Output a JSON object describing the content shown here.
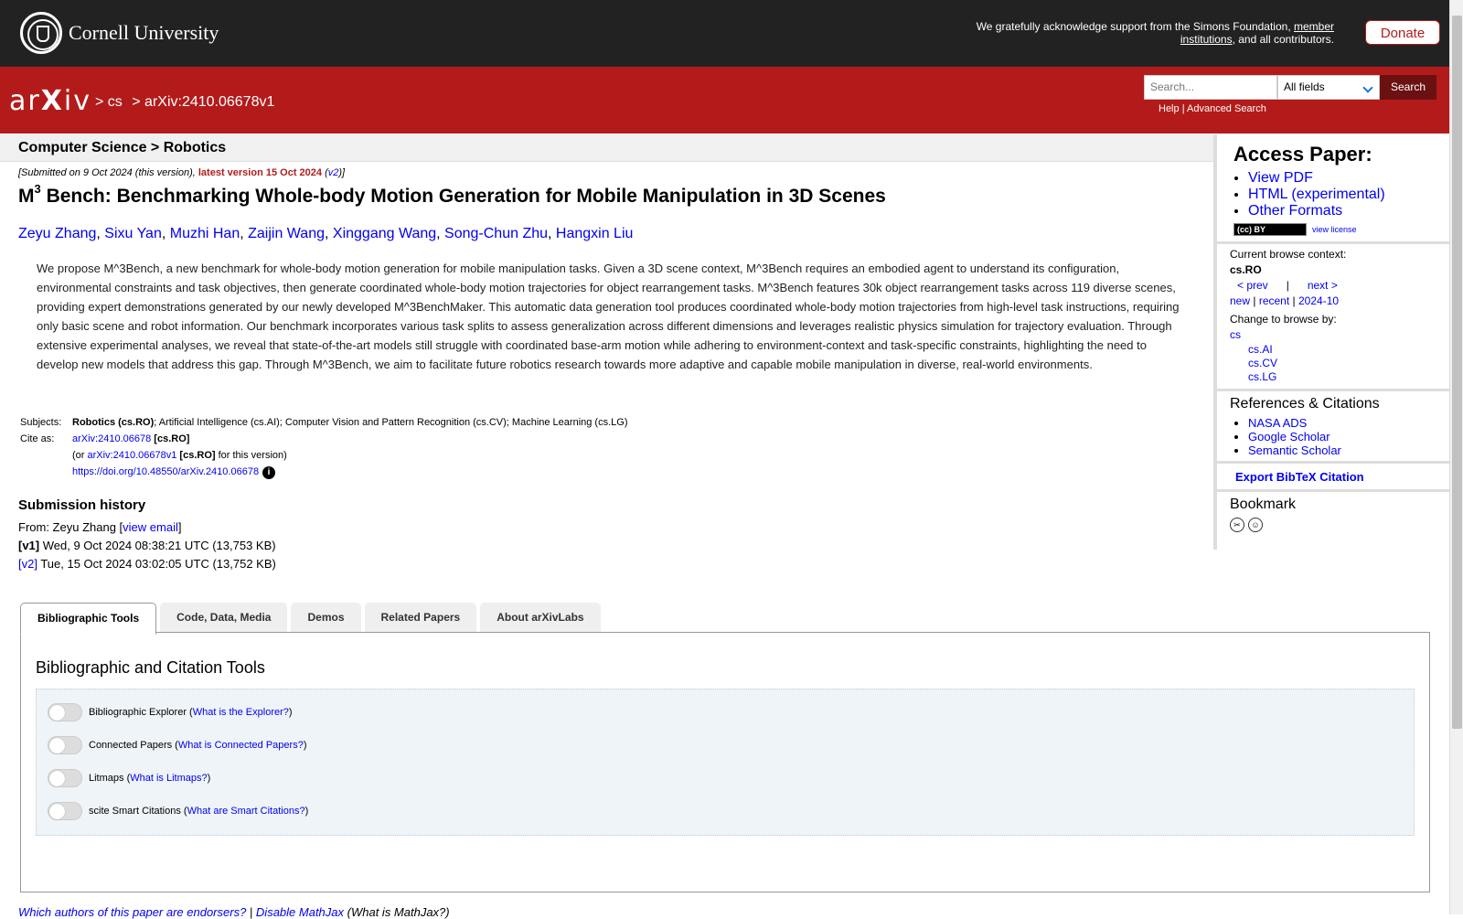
{
  "topbar": {
    "logo_text": "Cornell University",
    "ack_text": "We gratefully acknowledge support from the Simons Foundation, ",
    "ack_link": "member institutions",
    "ack_end": ", and all contributors.",
    "donate": "Donate"
  },
  "header": {
    "logo_a": "ar",
    "logo_x": "X",
    "logo_b": "iv",
    "crumb1": "> cs",
    "crumb2": "> arXiv:2410.06678v1",
    "search_placeholder": "Search...",
    "search_field": "All fields",
    "search_button": "Search",
    "help": "Help",
    "sep": "|",
    "advanced": "Advanced Search"
  },
  "subject_heading": "Computer Science > Robotics",
  "dateline": {
    "prefix": "[Submitted on 9 Oct 2024 (this version), ",
    "latest": "latest version 15 Oct 2024",
    "paren_open": " (",
    "v2": "v2",
    "suffix": ")]"
  },
  "title": {
    "m": "M",
    "sup": "3",
    "rest": "Bench: Benchmarking Whole-body Motion Generation for Mobile Manipulation in 3D Scenes"
  },
  "authors": [
    "Zeyu Zhang",
    "Sixu Yan",
    "Muzhi Han",
    "Zaijin Wang",
    "Xinggang Wang",
    "Song-Chun Zhu",
    "Hangxin Liu"
  ],
  "abstract": "We propose M^3Bench, a new benchmark for whole-body motion generation for mobile manipulation tasks. Given a 3D scene context, M^3Bench requires an embodied agent to understand its configuration, environmental constraints and task objectives, then generate coordinated whole-body motion trajectories for object rearrangement tasks. M^3Bench features 30k object rearrangement tasks across 119 diverse scenes, providing expert demonstrations generated by our newly developed M^3BenchMaker. This automatic data generation tool produces coordinated whole-body motion trajectories from high-level task instructions, requiring only basic scene and robot information. Our benchmark incorporates various task splits to assess generalization across different dimensions and leverages realistic physics simulation for trajectory evaluation. Through extensive experimental analyses, we reveal that state-of-the-art models still struggle with coordinated base-arm motion while adhering to environment-context and task-specific constraints, highlighting the need to develop new models that address this gap. Through M^3Bench, we aim to facilitate future robotics research towards more adaptive and capable mobile manipulation in diverse, real-world environments.",
  "meta": {
    "subjects_label": "Subjects:",
    "subjects_primary": "Robotics (cs.RO)",
    "subjects_rest": "; Artificial Intelligence (cs.AI); Computer Vision and Pattern Recognition (cs.CV); Machine Learning (cs.LG)",
    "cite_label": "Cite as:",
    "cite_id": "arXiv:2410.06678",
    "cite_cat": "[cs.RO]",
    "cite2_pre": "(or ",
    "cite2_id": "arXiv:2410.06678v1",
    "cite2_cat": "[cs.RO]",
    "cite2_post": " for this version)",
    "doi": "https://doi.org/10.48550/arXiv.2410.06678",
    "info_glyph": "i"
  },
  "history": {
    "heading": "Submission history",
    "from_pre": "From: Zeyu Zhang [",
    "from_link": "view email",
    "from_post": "]",
    "v1_label": "[v1]",
    "v1_text": " Wed, 9 Oct 2024 08:38:21 UTC (13,753 KB)",
    "v2_label": "[v2]",
    "v2_text": " Tue, 15 Oct 2024 03:02:05 UTC (13,752 KB)"
  },
  "tabs": [
    "Bibliographic Tools",
    "Code, Data, Media",
    "Demos",
    "Related Papers",
    "About arXivLabs"
  ],
  "panel": {
    "title": "Bibliographic and Citation Tools",
    "tools": [
      {
        "label": "Bibliographic Explorer (",
        "link": "What is the Explorer?",
        "end": ")"
      },
      {
        "label": "Connected Papers (",
        "link": "What is Connected Papers?",
        "end": ")"
      },
      {
        "label": "Litmaps (",
        "link": "What is Litmaps?",
        "end": ")"
      },
      {
        "label": "scite Smart Citations (",
        "link": "What are Smart Citations?",
        "end": ")"
      }
    ]
  },
  "bottom": {
    "endorsers": "Which authors of this paper are endorsers?",
    "sep": " | ",
    "mathjax": "Disable MathJax",
    "what": " (What is MathJax?)"
  },
  "sidebar": {
    "access_heading": "Access Paper:",
    "access_links": [
      "View PDF",
      "HTML (experimental)",
      "Other Formats"
    ],
    "cc_badge": "(cc) BY",
    "view_license": "view license",
    "context_label": "Current browse context:",
    "context_value": "cs.RO",
    "prev": "< prev",
    "pipe": "|",
    "next": "next >",
    "new": "new",
    "recent": "recent",
    "month": "2024-10",
    "change_label": "Change to browse by:",
    "browse_root": "cs",
    "browse_subs": [
      "cs.AI",
      "cs.CV",
      "cs.LG"
    ],
    "refs_heading": "References & Citations",
    "refs": [
      "NASA ADS",
      "Google Scholar",
      "Semantic Scholar"
    ],
    "export": "Export BibTeX Citation",
    "bookmark_heading": "Bookmark",
    "bookmark_icons": [
      "bibsonomy-icon",
      "reddit-icon"
    ]
  },
  "colors": {
    "brand_red": "#b31b1b",
    "topbar": "#222222",
    "link": "#0000ee"
  }
}
